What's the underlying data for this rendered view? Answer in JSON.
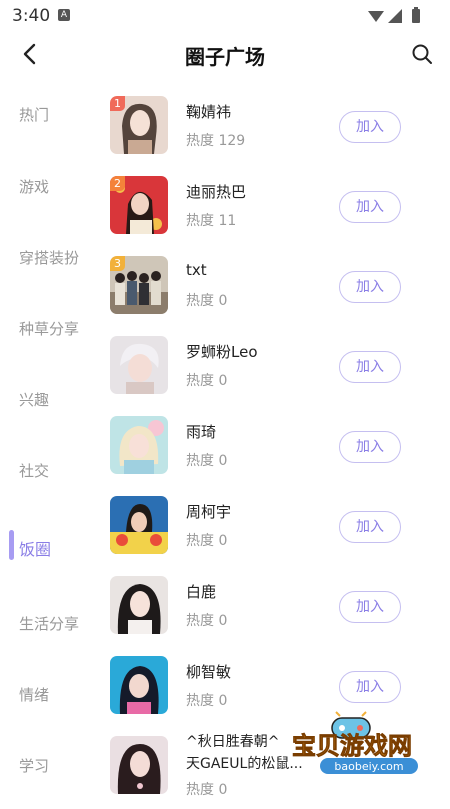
{
  "status_bar": {
    "time": "3:40",
    "badge": "A"
  },
  "header": {
    "title": "圈子广场"
  },
  "sidebar": {
    "items": [
      {
        "label": "热门"
      },
      {
        "label": "游戏"
      },
      {
        "label": "穿搭装扮"
      },
      {
        "label": "种草分享"
      },
      {
        "label": "兴趣"
      },
      {
        "label": "社交"
      },
      {
        "label": "饭圈"
      },
      {
        "label": "生活分享"
      },
      {
        "label": "情绪"
      },
      {
        "label": "学习"
      }
    ],
    "active_index": 6
  },
  "circles": [
    {
      "rank": "1",
      "name": "鞠婧祎",
      "heat": "热度 129",
      "join": "加入"
    },
    {
      "rank": "2",
      "name": "迪丽热巴",
      "heat": "热度 11",
      "join": "加入"
    },
    {
      "rank": "3",
      "name": "txt",
      "heat": "热度 0",
      "join": "加入"
    },
    {
      "name": "罗蛳粉Leo",
      "heat": "热度 0",
      "join": "加入"
    },
    {
      "name": "雨琦",
      "heat": "热度 0",
      "join": "加入"
    },
    {
      "name": "周柯宇",
      "heat": "热度 0",
      "join": "加入"
    },
    {
      "name": "白鹿",
      "heat": "热度 0",
      "join": "加入"
    },
    {
      "name": "柳智敏",
      "heat": "热度 0",
      "join": "加入"
    },
    {
      "name_line1": "^秋日胜春朝^",
      "name_line2": "天GAEUL的松鼠...",
      "heat": "热度 0"
    }
  ],
  "colors": {
    "accent": "#8a7ee6",
    "rank1": "#f06a5a",
    "rank2": "#f4823a",
    "rank3": "#f2b13a"
  },
  "watermark": {
    "text": "宝贝游戏网",
    "url": "baobeiy.com"
  }
}
